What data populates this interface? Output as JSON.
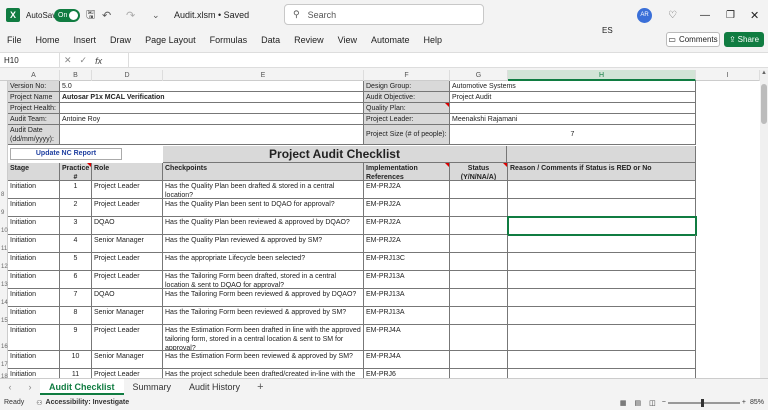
{
  "app": {
    "autosave_label": "AutoSave",
    "autosave_state": "On",
    "file_title": "Audit.xlsm • Saved",
    "search_placeholder": "Search",
    "user_initials": "AR",
    "lang": "ES"
  },
  "menu": [
    "File",
    "Home",
    "Insert",
    "Draw",
    "Page Layout",
    "Formulas",
    "Data",
    "Review",
    "View",
    "Automate",
    "Help"
  ],
  "ribbon_buttons": {
    "comments": "Comments",
    "share": "Share"
  },
  "formula_bar": {
    "name_box": "H10",
    "fx": "fx",
    "value": ""
  },
  "columns": [
    "A",
    "B",
    "D",
    "E",
    "F",
    "G",
    "H",
    "I"
  ],
  "info": {
    "version_label": "Version No:",
    "version_value": "5.0",
    "project_name_label": "Project Name",
    "project_name_value": "Autosar P1x MCAL Verification",
    "health_label": "Project Health:",
    "audit_team_label": "Audit Team:",
    "audit_team_value": "Antoine Roy",
    "audit_date_label": "Audit Date\n(dd/mm/yyyy):",
    "design_group_label": "Design Group:",
    "design_group_value": "Automotive Systems",
    "objective_label": "Audit Objective:",
    "objective_value": "Project Audit",
    "quality_plan_label": "Quality Plan:",
    "leader_label": "Project Leader:",
    "leader_value": "Meenakshi Rajamani",
    "size_label": "Project Size (# of people):",
    "size_value": "7"
  },
  "nc_button": "Update NC Report",
  "sheet_title": "Project Audit Checklist",
  "table_headers": {
    "stage": "Stage",
    "practice": "Practice\n#",
    "role": "Role",
    "checkpoints": "Checkpoints",
    "impl": "Implementation\nReferences",
    "status": "Status\n(Y/N/NA/A)",
    "reason": "Reason / Comments if Status is RED or No"
  },
  "rows": [
    {
      "rownum": "8",
      "stage": "Initiation",
      "practice": "1",
      "role": "Project Leader",
      "check": "Has the Quality Plan been drafted & stored in a central location?",
      "ref": "EM-PRJ2A"
    },
    {
      "rownum": "9",
      "stage": "Initiation",
      "practice": "2",
      "role": "Project Leader",
      "check": "Has the Quality Plan been sent to DQAO for approval?",
      "ref": "EM-PRJ2A"
    },
    {
      "rownum": "10",
      "stage": "Initiation",
      "practice": "3",
      "role": "DQAO",
      "check": "Has the Quality Plan been reviewed & approved by DQAO?",
      "ref": "EM-PRJ2A"
    },
    {
      "rownum": "11",
      "stage": "Initiation",
      "practice": "4",
      "role": "Senior Manager",
      "check": "Has the Quality Plan reviewed & approved by SM?",
      "ref": "EM-PRJ2A"
    },
    {
      "rownum": "12",
      "stage": "Initiation",
      "practice": "5",
      "role": "Project Leader",
      "check": "Has the appropriate Lifecycle been selected?",
      "ref": "EM-PRJ13C"
    },
    {
      "rownum": "13",
      "stage": "Initiation",
      "practice": "6",
      "role": "Project Leader",
      "check": "Has the Tailoring Form been drafted, stored in a central location & sent to DQAO for approval?",
      "ref": "EM-PRJ13A"
    },
    {
      "rownum": "14",
      "stage": "Initiation",
      "practice": "7",
      "role": "DQAO",
      "check": "Has the Tailoring Form been reviewed & approved by DQAO?",
      "ref": "EM-PRJ13A"
    },
    {
      "rownum": "15",
      "stage": "Initiation",
      "practice": "8",
      "role": "Senior Manager",
      "check": "Has the Tailoring Form been reviewed & approved by SM?",
      "ref": "EM-PRJ13A"
    },
    {
      "rownum": "16",
      "stage": "Initiation",
      "practice": "9",
      "role": "Project Leader",
      "check": "Has the Estimation Form been drafted in line with the approved tailoring form, stored in a central location & sent to SM for approval?",
      "ref": "EM-PRJ4A"
    },
    {
      "rownum": "17",
      "stage": "Initiation",
      "practice": "10",
      "role": "Senior Manager",
      "check": "Has the Estimation Form been reviewed & approved by SM?",
      "ref": "EM-PRJ4A"
    },
    {
      "rownum": "18",
      "stage": "Initiation",
      "practice": "11",
      "role": "Project Leader",
      "check": "Has the project schedule been drafted/created in-line with the",
      "ref": "EM-PRJ6"
    }
  ],
  "sheets": [
    "Audit Checklist",
    "Summary",
    "Audit History"
  ],
  "status": {
    "ready": "Ready",
    "accessibility": "Accessibility: Investigate",
    "zoom": "85%"
  }
}
